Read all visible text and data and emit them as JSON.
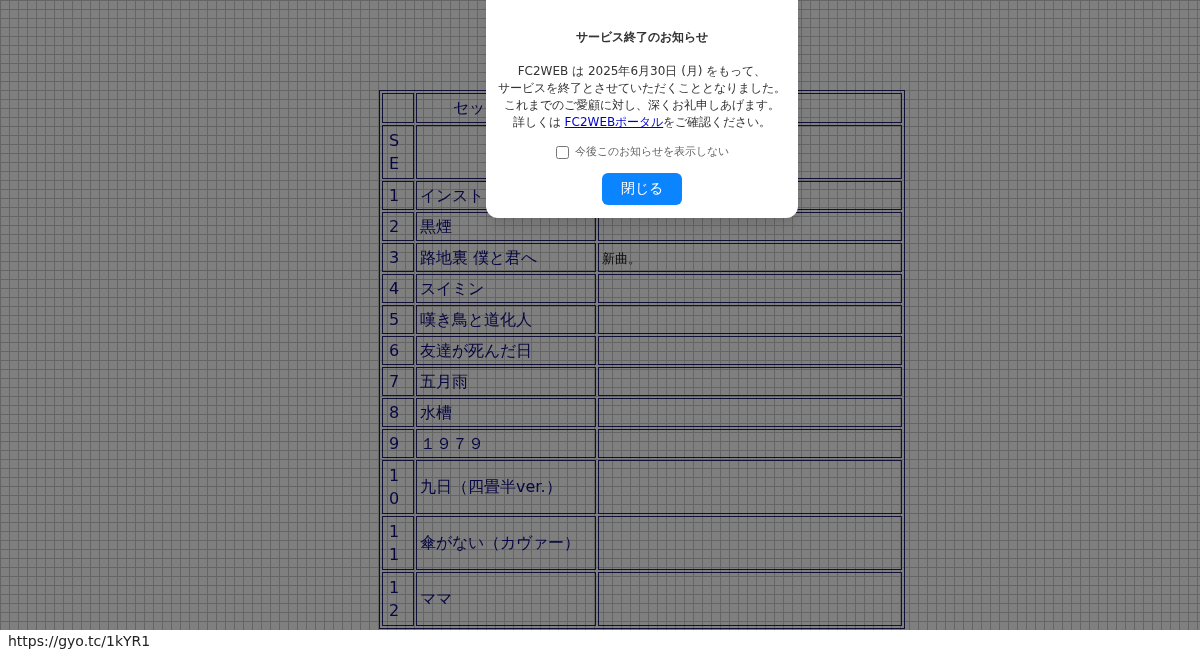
{
  "table": {
    "header": "セッ",
    "rows": [
      {
        "number": "SE"
      },
      {
        "number": "1",
        "title": "インスト"
      },
      {
        "number": "2",
        "title": "黒煙"
      },
      {
        "number": "3",
        "title": "路地裏 僕と君へ",
        "note": "新曲。"
      },
      {
        "number": "4",
        "title": "スイミン"
      },
      {
        "number": "5",
        "title": "嘆き鳥と道化人"
      },
      {
        "number": "6",
        "title": "友達が死んだ日"
      },
      {
        "number": "7",
        "title": "五月雨"
      },
      {
        "number": "8",
        "title": "水槽"
      },
      {
        "number": "9",
        "title": "１９７９"
      },
      {
        "number": "10",
        "title": "九日（四畳半ver.）"
      },
      {
        "number": "11",
        "title": "傘がない（カヴァー）"
      },
      {
        "number": "12",
        "title": "ママ"
      }
    ]
  },
  "notice": {
    "title": "サービス終了のお知らせ",
    "lines": [
      "FC2WEB は 2025年6月30日 (月) をもって、",
      "サービスを終了とさせていただくこととなりました。",
      "これまでのご愛顧に対し、深くお礼申しあげます。"
    ],
    "last_line": {
      "before": "詳しくは ",
      "link": "FC2WEBポータル",
      "after": "をご確認ください。"
    },
    "checkbox": {
      "label": "今後このお知らせを表示しない",
      "checked": false
    },
    "button": "閉じる"
  },
  "status_bar": {
    "url": "https://gyo.tc/1kYR1"
  }
}
